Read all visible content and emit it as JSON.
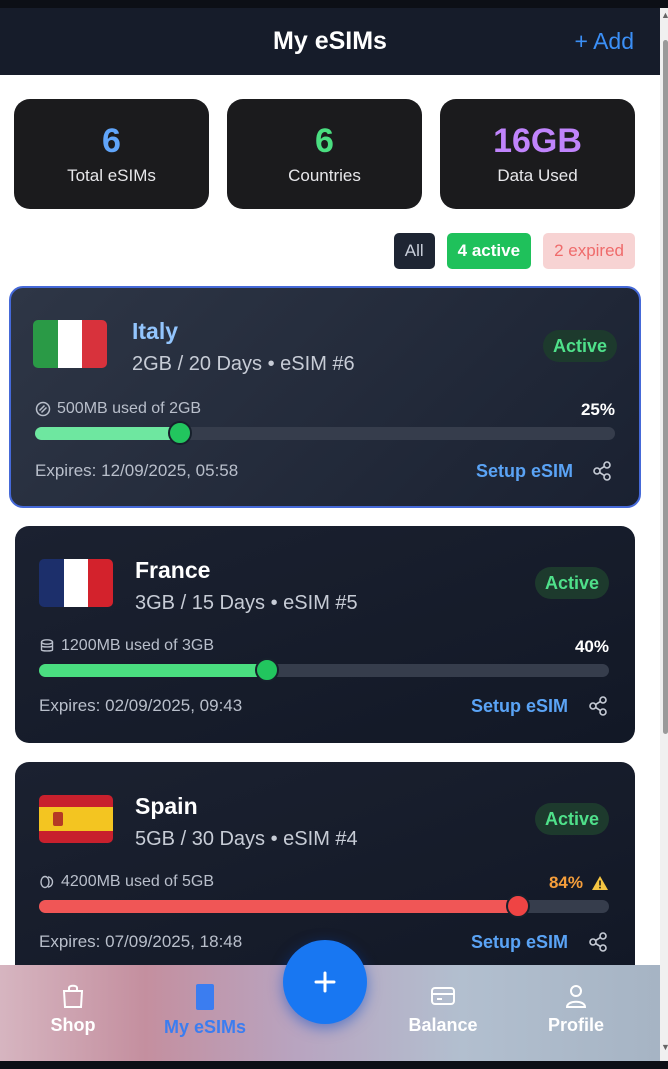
{
  "header": {
    "title": "My eSIMs",
    "add_label": "+ Add"
  },
  "stats": [
    {
      "value": "6",
      "label": "Total eSIMs",
      "color": "#60a5fa"
    },
    {
      "value": "6",
      "label": "Countries",
      "color": "#4ade80"
    },
    {
      "value": "16GB",
      "label": "Data Used",
      "color": "#c084fc"
    }
  ],
  "filters": {
    "all": "All",
    "active": "4 active",
    "expired": "2 expired"
  },
  "esims": [
    {
      "country": "Italy",
      "plan": "2GB / 20 Days • eSIM #6",
      "status": "Active",
      "usage": "500MB used of 2GB",
      "percent_label": "25%",
      "percent": 0.25,
      "expires": "Expires: 12/09/2025, 05:58",
      "setup_label": "Setup eSIM",
      "flag_colors": [
        "#2a9a46",
        "#ffffff",
        "#d8323c"
      ],
      "bar_color": "#6ee7a0",
      "country_color": "#93c5fd"
    },
    {
      "country": "France",
      "plan": "3GB / 15 Days • eSIM #5",
      "status": "Active",
      "usage": "1200MB used of 3GB",
      "percent_label": "40%",
      "percent": 0.4,
      "expires": "Expires: 02/09/2025, 09:43",
      "setup_label": "Setup eSIM",
      "flag_colors": [
        "#1c2f6b",
        "#ffffff",
        "#d3222c"
      ],
      "bar_color": "#4ade80",
      "country_color": "#ffffff"
    },
    {
      "country": "Spain",
      "plan": "5GB / 30 Days • eSIM #4",
      "status": "Active",
      "usage": "4200MB used of 5GB",
      "percent_label": "84%",
      "percent": 0.84,
      "expires": "Expires: 07/09/2025, 18:48",
      "setup_label": "Setup eSIM",
      "flag_colors": [
        "#c8202d",
        "#f3c521",
        "#c8202d"
      ],
      "bar_color": "#f05656",
      "country_color": "#ffffff"
    }
  ],
  "nav": {
    "shop": "Shop",
    "my_esims": "My eSIMs",
    "balance": "Balance",
    "profile": "Profile"
  }
}
